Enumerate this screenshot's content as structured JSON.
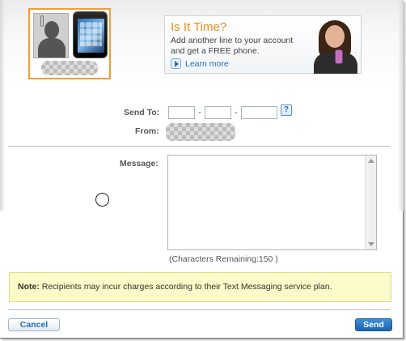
{
  "recipient": {
    "avatar_icon": "person-silhouette-icon",
    "phone_icon": "smartphone-icon"
  },
  "ad": {
    "title": "Is It Time?",
    "text": "Add another line to your account and get a FREE phone.",
    "link_label": "Learn more",
    "link_icon": "play-arrow-icon",
    "title_color": "#f08a1c"
  },
  "form": {
    "send_to_label": "Send To:",
    "dash": "-",
    "help_label": "?",
    "from_label": "From:",
    "message_label": "Message:",
    "message_value": "",
    "characters_remaining": "(Characters Remaining:150 )"
  },
  "note": {
    "label": "Note:",
    "text": " Recipients may incur charges according to their Text Messaging service plan."
  },
  "buttons": {
    "cancel": "Cancel",
    "send": "Send"
  },
  "colors": {
    "accent": "#1f6fb5",
    "profile_border": "#f39c33",
    "note_background": "#fbfac8"
  }
}
